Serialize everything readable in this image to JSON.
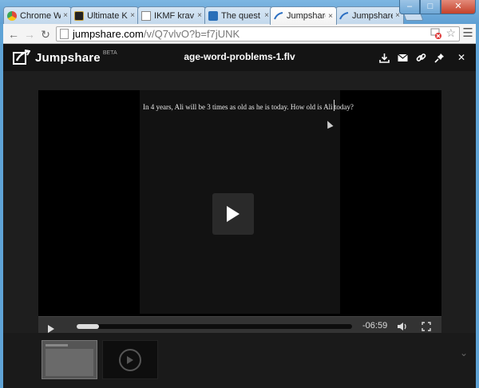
{
  "browser": {
    "tabs": [
      {
        "label": "Chrome W",
        "icon": "chrome-icon",
        "active": false
      },
      {
        "label": "Ultimate K",
        "icon": "ultimate-icon",
        "active": false
      },
      {
        "label": "IKMF krav",
        "icon": "page-icon",
        "active": false
      },
      {
        "label": "The quest",
        "icon": "trello-icon",
        "active": false
      },
      {
        "label": "Jumpshare",
        "icon": "jumpshare-icon",
        "active": true
      },
      {
        "label": "Jumpshare",
        "icon": "jumpshare-icon",
        "active": false
      }
    ],
    "tab_close_glyph": "×",
    "url_host": "jumpshare.com",
    "url_path": "/v/Q7vlvO?b=f7jUNK",
    "window_buttons": {
      "minimize": "–",
      "maximize": "□",
      "close": "✕"
    }
  },
  "app": {
    "logo_text": "Jumpshare",
    "logo_beta": "BETA",
    "file_name": "age-word-problems-1.flv",
    "header_icons": [
      "download-icon",
      "email-icon",
      "link-icon",
      "pin-icon",
      "close-icon"
    ],
    "close_glyph": "✕"
  },
  "player": {
    "caption": "In 4 years, Ali will be 3 times as old as he is today.  How old is Ali today?",
    "time_remaining": "-06:59",
    "progress": 0.02,
    "play_icon": "play-icon"
  },
  "thumbnails": {
    "expand_glyph": "⌄"
  }
}
